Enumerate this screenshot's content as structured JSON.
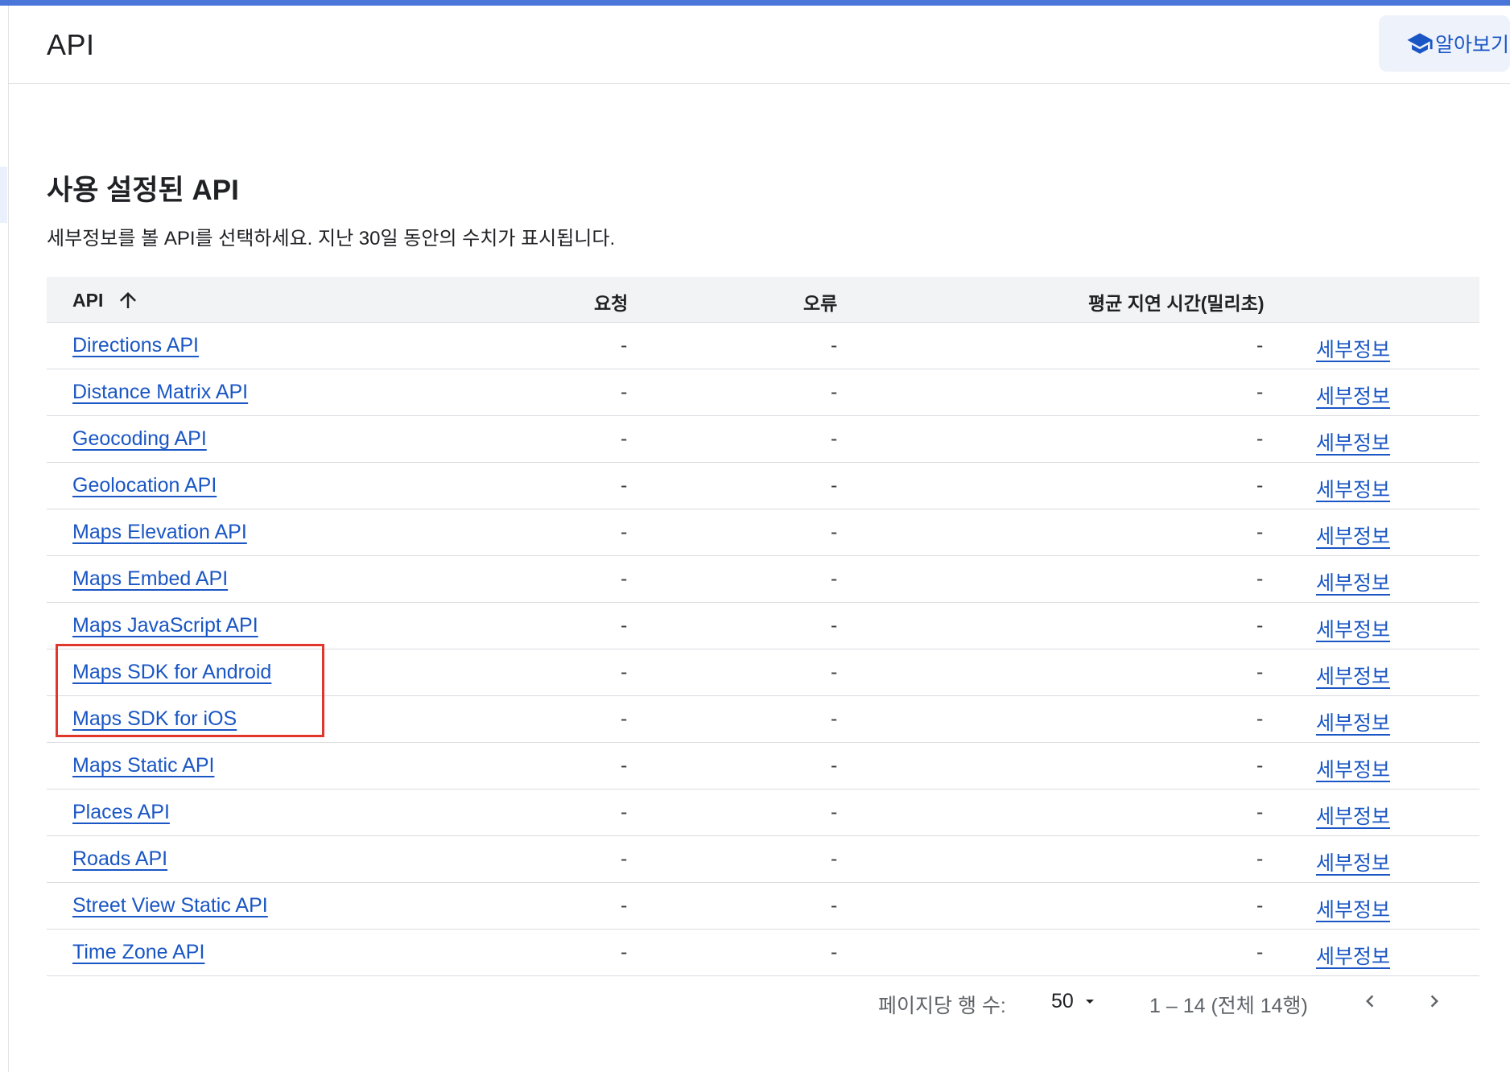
{
  "header": {
    "title": "API",
    "learn_label": "알아보기"
  },
  "section": {
    "title": "사용 설정된 API",
    "description": "세부정보를 볼 API를 선택하세요. 지난 30일 동안의 수치가 표시됩니다."
  },
  "table": {
    "columns": {
      "api": "API",
      "requests": "요청",
      "errors": "오류",
      "latency": "평균 지연 시간(밀리초)"
    },
    "sort": "ascending",
    "rows": [
      {
        "name": "Directions API",
        "requests": "-",
        "errors": "-",
        "latency": "-",
        "details": "세부정보"
      },
      {
        "name": "Distance Matrix API",
        "requests": "-",
        "errors": "-",
        "latency": "-",
        "details": "세부정보"
      },
      {
        "name": "Geocoding API",
        "requests": "-",
        "errors": "-",
        "latency": "-",
        "details": "세부정보"
      },
      {
        "name": "Geolocation API",
        "requests": "-",
        "errors": "-",
        "latency": "-",
        "details": "세부정보"
      },
      {
        "name": "Maps Elevation API",
        "requests": "-",
        "errors": "-",
        "latency": "-",
        "details": "세부정보"
      },
      {
        "name": "Maps Embed API",
        "requests": "-",
        "errors": "-",
        "latency": "-",
        "details": "세부정보"
      },
      {
        "name": "Maps JavaScript API",
        "requests": "-",
        "errors": "-",
        "latency": "-",
        "details": "세부정보"
      },
      {
        "name": "Maps SDK for Android",
        "requests": "-",
        "errors": "-",
        "latency": "-",
        "details": "세부정보"
      },
      {
        "name": "Maps SDK for iOS",
        "requests": "-",
        "errors": "-",
        "latency": "-",
        "details": "세부정보"
      },
      {
        "name": "Maps Static API",
        "requests": "-",
        "errors": "-",
        "latency": "-",
        "details": "세부정보"
      },
      {
        "name": "Places API",
        "requests": "-",
        "errors": "-",
        "latency": "-",
        "details": "세부정보"
      },
      {
        "name": "Roads API",
        "requests": "-",
        "errors": "-",
        "latency": "-",
        "details": "세부정보"
      },
      {
        "name": "Street View Static API",
        "requests": "-",
        "errors": "-",
        "latency": "-",
        "details": "세부정보"
      },
      {
        "name": "Time Zone API",
        "requests": "-",
        "errors": "-",
        "latency": "-",
        "details": "세부정보"
      }
    ]
  },
  "pager": {
    "rows_per_page_label": "페이지당 행 수:",
    "rows_per_page": "50",
    "range": "1 – 14 (전체 14행)"
  },
  "colors": {
    "accent": "#1a56c4",
    "top_bar": "#4a76d9",
    "highlight": "#e0362c"
  }
}
